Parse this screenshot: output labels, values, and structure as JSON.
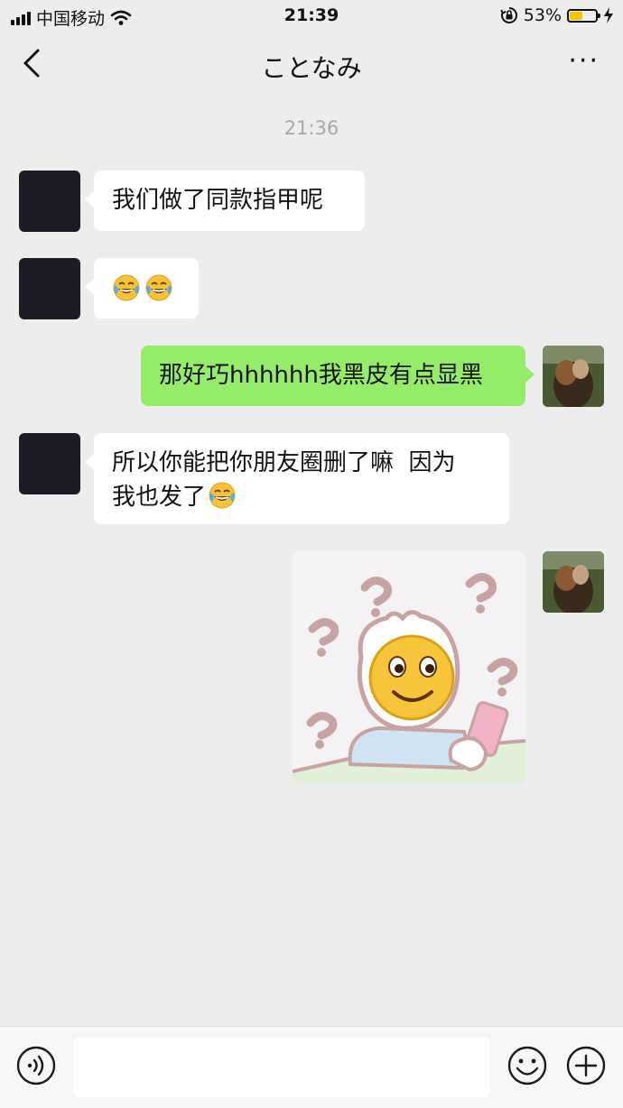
{
  "status_bar": {
    "carrier": "中国移动",
    "time": "21:39",
    "battery": "53%",
    "battery_level": 0.53
  },
  "header": {
    "title": "ことなみ",
    "more": "···"
  },
  "chat": {
    "timestamp": "21:36",
    "messages": [
      {
        "from": "other",
        "text": "我们做了同款指甲呢"
      },
      {
        "from": "other",
        "emoji": [
          "tears-of-joy",
          "tears-of-joy"
        ]
      },
      {
        "from": "me",
        "text": "那好巧hhhhhh我黑皮有点显黑"
      },
      {
        "from": "other",
        "line1": "所以你能把你朋友圈删了嘛  因为",
        "line2": "我也发了",
        "emoji": "tears-of-joy"
      },
      {
        "from": "me",
        "sticker": "confused-smiley-phone-sticker"
      }
    ]
  },
  "input_bar": {
    "icons": [
      "voice-icon",
      "emoji-icon",
      "plus-icon"
    ]
  },
  "colors": {
    "background": "#ededed",
    "outgoing": "#95ec69",
    "incoming": "#ffffff",
    "battery": "#f4c400"
  }
}
